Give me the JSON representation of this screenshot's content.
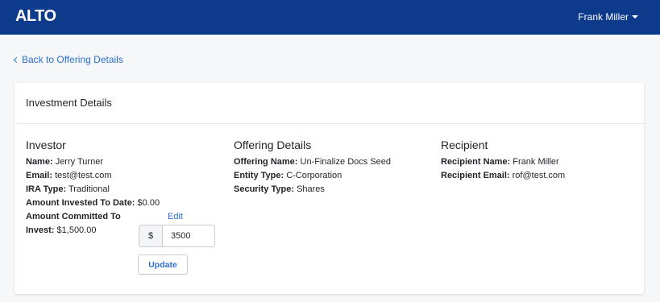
{
  "navbar": {
    "brand": "ALTO",
    "user_name": "Frank Miller"
  },
  "back_link": "Back to Offering Details",
  "card": {
    "title": "Investment Details",
    "investor": {
      "heading": "Investor",
      "name_label": "Name:",
      "name": "Jerry Turner",
      "email_label": "Email:",
      "email": "test@test.com",
      "ira_label": "IRA Type:",
      "ira": "Traditional",
      "invested_label": "Amount Invested To Date:",
      "invested": "$0.00",
      "committed_label_line1": "Amount Committed To",
      "edit_link": "Edit",
      "committed_label_line2": "Invest:",
      "committed": "$1,500.00",
      "currency_addon": "$",
      "amount_value": "3500",
      "update_button": "Update"
    },
    "offering": {
      "heading": "Offering Details",
      "name_label": "Offering Name:",
      "name": "Un-Finalize Docs Seed",
      "entity_label": "Entity Type:",
      "entity": "C-Corporation",
      "security_label": "Security Type:",
      "security": "Shares"
    },
    "recipient": {
      "heading": "Recipient",
      "name_label": "Recipient Name:",
      "name": "Frank Miller",
      "email_label": "Recipient Email:",
      "email": "rof@test.com"
    }
  },
  "colors": {
    "navbar": "#0d3a8a",
    "link": "#2c6fd1",
    "background": "#f5f7f9"
  }
}
